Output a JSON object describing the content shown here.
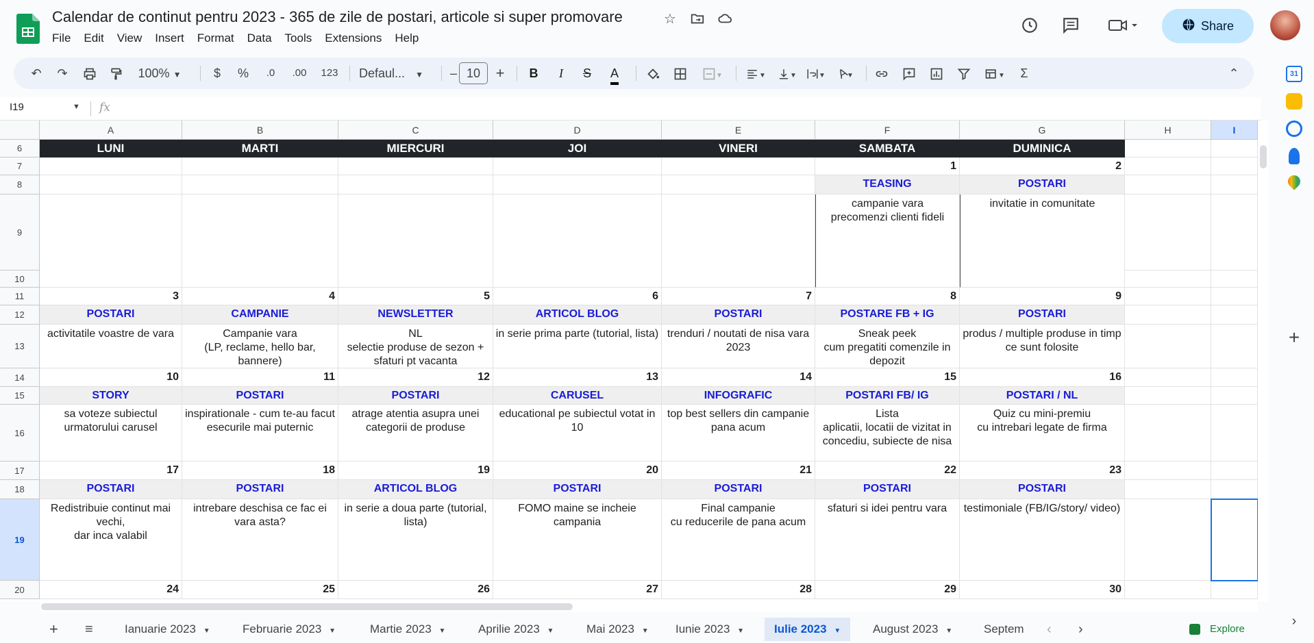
{
  "app": {
    "doc_title": "Calendar de continut pentru 2023 - 365 de zile de postari, articole si super promovare",
    "share_label": "Share",
    "menu": [
      "File",
      "Edit",
      "View",
      "Insert",
      "Format",
      "Data",
      "Tools",
      "Extensions",
      "Help"
    ]
  },
  "toolbar": {
    "zoom": "100%",
    "currency": "$",
    "percent": "%",
    "dec_dec": ".0",
    "inc_dec": ".00",
    "number_format": "123",
    "font": "Defaul...",
    "font_size": "10",
    "minus": "–",
    "plus": "+",
    "bold": "B",
    "italic": "I",
    "sigma": "Σ"
  },
  "formula": {
    "namebox": "I19",
    "fx": "fx"
  },
  "columns": [
    "A",
    "B",
    "C",
    "D",
    "E",
    "F",
    "G",
    "H",
    "I"
  ],
  "rows": [
    "6",
    "7",
    "8",
    "9",
    "10",
    "11",
    "12",
    "13",
    "14",
    "15",
    "16",
    "17",
    "18",
    "19",
    "20"
  ],
  "days": [
    "LUNI",
    "MARTI",
    "MIERCURI",
    "JOI",
    "VINERI",
    "SAMBATA",
    "DUMINICA"
  ],
  "week0": {
    "nums": [
      "",
      "",
      "",
      "",
      "",
      "1",
      "2"
    ],
    "labels": [
      "",
      "",
      "",
      "",
      "",
      "TEASING",
      "POSTARI"
    ],
    "texts": [
      "",
      "",
      "",
      "",
      "",
      "campanie vara\nprecomenzi clienti fideli",
      "invitatie in comunitate"
    ]
  },
  "week1": {
    "nums": [
      "3",
      "4",
      "5",
      "6",
      "7",
      "8",
      "9"
    ],
    "labels": [
      "POSTARI",
      "CAMPANIE",
      "NEWSLETTER",
      "ARTICOL BLOG",
      "POSTARI",
      "POSTARE FB + IG",
      "POSTARI"
    ],
    "texts": [
      "activitatile voastre de vara",
      "Campanie vara\n(LP, reclame, hello bar, bannere)",
      "NL\nselectie produse de sezon + sfaturi pt vacanta",
      "in serie prima parte (tutorial, lista)",
      "trenduri / noutati de nisa vara 2023",
      "Sneak peek\ncum pregatiti comenzile in depozit",
      "produs / multiple produse in timp ce sunt folosite"
    ]
  },
  "week2": {
    "nums": [
      "10",
      "11",
      "12",
      "13",
      "14",
      "15",
      "16"
    ],
    "labels": [
      "STORY",
      "POSTARI",
      "POSTARI",
      "CARUSEL",
      "INFOGRAFIC",
      "POSTARI FB/ IG",
      "POSTARI / NL"
    ],
    "texts": [
      "sa voteze subiectul urmatorului carusel",
      "inspirationale - cum te-au facut esecurile mai puternic",
      "atrage atentia asupra unei categorii de produse",
      "educational pe subiectul votat in 10",
      "top best sellers din campanie pana acum",
      "Lista\naplicatii, locatii de vizitat in concediu, subiecte de nisa",
      "Quiz cu mini-premiu\ncu intrebari legate de firma"
    ]
  },
  "week3": {
    "nums": [
      "17",
      "18",
      "19",
      "20",
      "21",
      "22",
      "23"
    ],
    "labels": [
      "POSTARI",
      "POSTARI",
      "ARTICOL BLOG",
      "POSTARI",
      "POSTARI",
      "POSTARI",
      "POSTARI"
    ],
    "texts": [
      "Redistribuie continut mai vechi,\ndar inca valabil",
      "intrebare deschisa ce fac ei vara asta?",
      "in serie a doua parte (tutorial, lista)",
      "FOMO maine se incheie campania",
      "Final campanie\ncu reducerile de pana acum",
      "sfaturi si idei pentru vara",
      "testimoniale (FB/IG/story/ video)"
    ]
  },
  "week4": {
    "nums": [
      "24",
      "25",
      "26",
      "27",
      "28",
      "29",
      "30"
    ]
  },
  "sheets": {
    "tabs": [
      "Ianuarie 2023",
      "Februarie 2023",
      "Martie 2023",
      "Aprilie 2023",
      "Mai 2023",
      "Iunie 2023",
      "Iulie 2023",
      "August 2023",
      "Septem"
    ],
    "active": "Iulie 2023",
    "explore": "Explore"
  },
  "colors": {
    "accent": "#1a1bd6",
    "header_bg": "#212529",
    "share_bg": "#c2e7ff",
    "selection": "#1a73e8"
  }
}
